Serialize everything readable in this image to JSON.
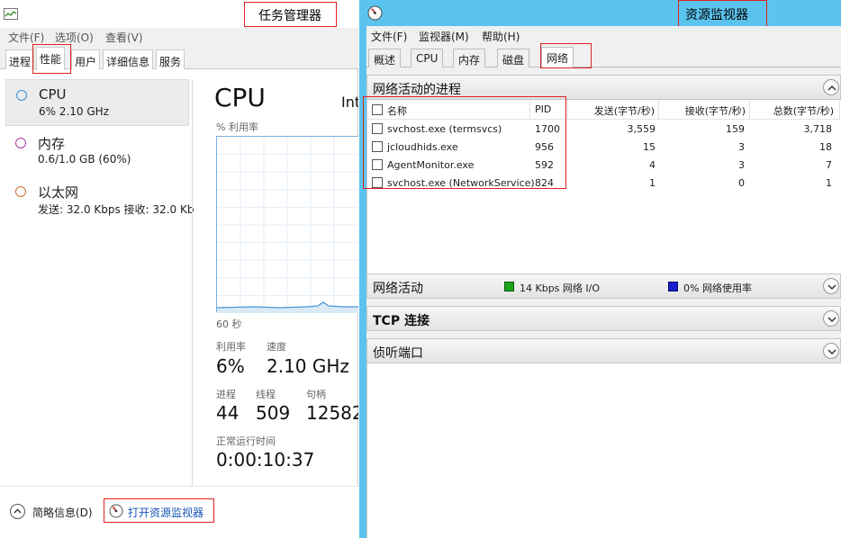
{
  "task_manager": {
    "title_annotation": "任务管理器",
    "menu": [
      "文件(F)",
      "选项(O)",
      "查看(V)"
    ],
    "tabs": [
      "进程",
      "性能",
      "用户",
      "详细信息",
      "服务"
    ],
    "active_tab": "性能",
    "resources": [
      {
        "name": "CPU",
        "detail": "6%  2.10 GHz",
        "ring_color": "#3c8fd4"
      },
      {
        "name": "内存",
        "detail": "0.6/1.0 GB (60%)",
        "ring_color": "#a63ca6"
      },
      {
        "name": "以太网",
        "detail": "发送: 32.0 Kbps 接收: 32.0 Kb",
        "ring_color": "#c87137"
      }
    ],
    "detail": {
      "heading": "CPU",
      "model_partial": "Int",
      "graph_label": "% 利用率",
      "time_label": "60 秒",
      "utilization_label": "利用率",
      "utilization_value": "6%",
      "speed_label": "速度",
      "speed_value": "2.10 GHz",
      "processes_label": "进程",
      "processes_value": "44",
      "threads_label": "线程",
      "threads_value": "509",
      "handles_label": "句柄",
      "handles_value": "12582",
      "uptime_label": "正常运行时间",
      "uptime_value": "0:00:10:37"
    },
    "footer": {
      "brief_label": "简略信息(D)",
      "open_monitor_label": "打开资源监视器"
    }
  },
  "resource_monitor": {
    "title_annotation": "资源监视器",
    "menu": [
      "文件(F)",
      "监视器(M)",
      "帮助(H)"
    ],
    "tabs": [
      "概述",
      "CPU",
      "内存",
      "磁盘",
      "网络"
    ],
    "active_tab": "网络",
    "process_section": {
      "title": "网络活动的进程",
      "columns": [
        "名称",
        "PID",
        "发送(字节/秒)",
        "接收(字节/秒)",
        "总数(字节/秒)"
      ],
      "rows": [
        {
          "name": "svchost.exe (termsvcs)",
          "pid": "1700",
          "send": "3,559",
          "recv": "159",
          "total": "3,718"
        },
        {
          "name": "jcloudhids.exe",
          "pid": "956",
          "send": "15",
          "recv": "3",
          "total": "18"
        },
        {
          "name": "AgentMonitor.exe",
          "pid": "592",
          "send": "4",
          "recv": "3",
          "total": "7"
        },
        {
          "name": "svchost.exe (NetworkService)",
          "pid": "824",
          "send": "1",
          "recv": "0",
          "total": "1"
        }
      ]
    },
    "network_activity": {
      "title": "网络活动",
      "io_label": "14 Kbps 网络 I/O",
      "io_color": "#1aa51a",
      "usage_label": "0% 网络使用率",
      "usage_color": "#1a1ad0"
    },
    "tcp_section": {
      "title": "TCP 连接"
    },
    "listen_section": {
      "title": "侦听端口"
    }
  }
}
